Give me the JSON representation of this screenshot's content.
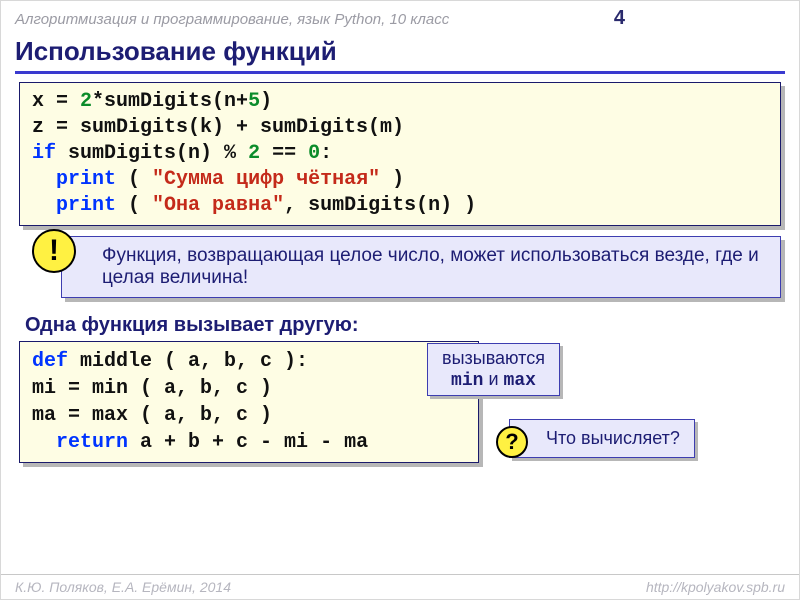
{
  "header": {
    "course": "Алгоритмизация и программирование, язык Python, 10 класс",
    "page_number": "4"
  },
  "title": "Использование функций",
  "code1": {
    "l1_a": "x = ",
    "l1_b": "2",
    "l1_c": "*sumDigits(n+",
    "l1_d": "5",
    "l1_e": ")",
    "l2": "z = sumDigits(k) + sumDigits(m)",
    "l3_a": "if",
    "l3_b": " sumDigits(n)",
    "l3_c": " % ",
    "l3_d": "2",
    "l3_e": " == ",
    "l3_f": "0",
    "l3_g": ":",
    "l4_a": "print",
    "l4_b": " ( ",
    "l4_c": "\"Сумма цифр чётная\"",
    "l4_d": " )",
    "l5_a": "print",
    "l5_b": " ( ",
    "l5_c": "\"Она равна\"",
    "l5_d": ", sumDigits(n) )"
  },
  "note": {
    "bang": "!",
    "text": "Функция, возвращающая целое число, может использоваться везде, где и целая величина!"
  },
  "subhead": "Одна функция вызывает другую:",
  "code2": {
    "l1_a": "def",
    "l1_b": " middle ( a, b, c ):",
    "l2": "  mi = min ( a, b, c )",
    "l3": "  ma = max ( a, b, c )",
    "l4_a": "return",
    "l4_b": " a + b + c - mi - ma"
  },
  "callout": {
    "line1": "вызываются",
    "m1": "min",
    "and": " и ",
    "m2": "max"
  },
  "question": {
    "mark": "?",
    "text": "Что вычисляет?"
  },
  "footer": {
    "left": "К.Ю. Поляков, Е.А. Ерёмин, 2014",
    "right": "http://kpolyakov.spb.ru"
  }
}
